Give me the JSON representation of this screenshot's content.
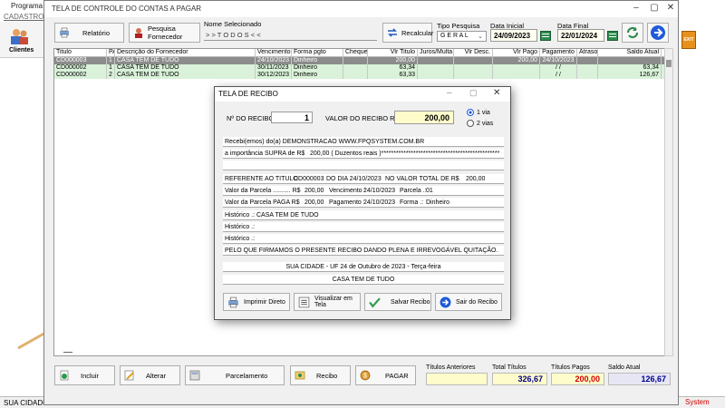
{
  "background_app": {
    "title": "Programa F",
    "menu_cadastros": "CADASTROS",
    "clientes_label": "Clientes",
    "status_text": "SUA CIDADE -",
    "system_text": "System",
    "exit_label": "EXIT"
  },
  "window": {
    "title": "TELA DE CONTROLE DO CONTAS A PAGAR",
    "toolbar": {
      "relatorio": "Relatório",
      "pesquisa_fornecedor": "Pesquisa Fornecedor",
      "nome_selecionado_label": "Nome Selecionado",
      "nome_selecionado_value": "> > T O D O S < <",
      "recalcular": "Recalcular",
      "tipo_pesquisa_label": "Tipo  Pesquisa",
      "tipo_pesquisa_value": "G E R A L",
      "data_inicial_label": "Data Inicial",
      "data_inicial_value": "24/09/2023",
      "data_final_label": "Data Final",
      "data_final_value": "22/01/2024"
    },
    "table": {
      "headers": [
        "Titulo",
        "PA",
        "Descrição do Fornecedor",
        "Vencimento",
        "Forma pgto",
        "Cheque",
        "Vlr Titulo",
        "Juros/Multa",
        "Vlr Desc.",
        "Vlr Pago",
        "Pagamento",
        "Atraso",
        "Saldo Atual"
      ],
      "rows": [
        [
          "CD000003",
          "1",
          "CASA TEM DE TUDO",
          "24/10/2023",
          "Dinheiro",
          "",
          "200,00",
          "",
          "",
          "200,00",
          "24/10/2023",
          "",
          ""
        ],
        [
          "CD000002",
          "1",
          "CASA TEM DE TUDO",
          "30/11/2023",
          "Dinheiro",
          "",
          "63,34",
          "",
          "",
          "",
          "/ /",
          "",
          "63,34"
        ],
        [
          "CD000002",
          "2",
          "CASA TEM DE TUDO",
          "30/12/2023",
          "Dinheiro",
          "",
          "63,33",
          "",
          "",
          "",
          "/ /",
          "",
          "126,67"
        ]
      ]
    },
    "bottom_buttons": {
      "incluir": "Incluir",
      "alterar": "Alterar",
      "parcelamento": "Parcelamento",
      "recibo": "Recibo",
      "pagar": "PAGAR"
    },
    "totals": {
      "titulos_anteriores_label": "Títulos Anteriores",
      "titulos_anteriores_value": "",
      "total_titulos_label": "Total Títulos",
      "total_titulos_value": "326,67",
      "titulos_pagos_label": "Títulos Pagos",
      "titulos_pagos_value": "200,00",
      "saldo_atual_label": "Saldo Atual",
      "saldo_atual_value": "126,67"
    }
  },
  "modal": {
    "title": "TELA DE RECIBO",
    "n_recibo_label": "Nº DO RECIBO",
    "n_recibo_value": "1",
    "valor_recibo_label": "VALOR DO RECIBO R$",
    "valor_recibo_value": "200,00",
    "via_options": [
      "1 via",
      "2 vias"
    ],
    "lines": {
      "recebemos": "Recebi(emos) do(a) DEMONSTRACAO WWW.FPQSYSTEM.COM.BR",
      "importancia_label": "a importância SUPRA de R$",
      "importancia_value": "200,00 ( Duzentos reais )************************************************",
      "referente_label": "REFERENTE AO TITULO",
      "referente_titulo": "CD000003",
      "referente_dia": "DO DIA 24/10/2023",
      "referente_valor_label": "NO VALOR TOTAL DE R$",
      "referente_valor": "200,00",
      "valor_parcela_label": "Valor da Parcela .......... R$",
      "valor_parcela": "200,00",
      "vencimento_label": "Vencimento :",
      "vencimento": "24/10/2023",
      "parcela_label": "Parcela .:",
      "parcela": "01",
      "valor_paga_label": "Valor da Parcela PAGA R$",
      "valor_paga": "200,00",
      "pagamento_label": "Pagamento :",
      "pagamento": "24/10/2023",
      "forma_label": "Forma .:",
      "forma": "Dinheiro",
      "historico1": "Histórico .: CASA TEM DE TUDO",
      "historico2": "Histórico .:",
      "historico3": "Histórico .:",
      "declaracao": "PELO QUE FIRMAMOS O PRESENTE RECIBO DANDO PLENA E IRREVOGÁVEL QUITAÇÃO.",
      "cidade_data": "SUA CIDADE - UF 24 de Outubro de 2023 - Terça-feira",
      "empresa": "CASA TEM DE TUDO"
    },
    "buttons": {
      "imprimir": "Imprimir Direto",
      "visualizar": "Visualizar em Tela",
      "salvar": "Salvar Recibo",
      "sair": "Sair do Recibo"
    }
  },
  "colors": {
    "row_selected": "#8c8c8c",
    "row_pending": "#d9f2d9",
    "pagos_red": "#d00000",
    "total_blue": "#00008b",
    "valor_recibo_bg": "#fffccc"
  }
}
